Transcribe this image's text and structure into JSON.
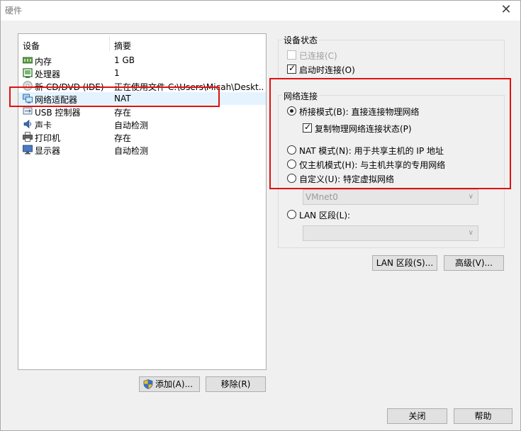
{
  "window": {
    "title": "硬件"
  },
  "device_list": {
    "col_device": "设备",
    "col_summary": "摘要",
    "rows": [
      {
        "name": "内存",
        "summary": "1 GB",
        "icon": "memory-icon",
        "iconColor": "#4a8a3a"
      },
      {
        "name": "处理器",
        "summary": "1",
        "icon": "processor-icon",
        "iconColor": "#3a7a3a"
      },
      {
        "name": "新 CD/DVD (IDE)",
        "summary": "正在使用文件 C:\\Users\\Micah\\Deskt...",
        "icon": "cd-dvd-icon",
        "iconColor": "#9a9a9a"
      },
      {
        "name": "网络适配器",
        "summary": "NAT",
        "icon": "network-adapter-icon",
        "iconColor": "#2a6aa0"
      },
      {
        "name": "USB 控制器",
        "summary": "存在",
        "icon": "usb-icon",
        "iconColor": "#4a6a8a"
      },
      {
        "name": "声卡",
        "summary": "自动检测",
        "icon": "sound-card-icon",
        "iconColor": "#2a5a9a"
      },
      {
        "name": "打印机",
        "summary": "存在",
        "icon": "printer-icon",
        "iconColor": "#555555"
      },
      {
        "name": "显示器",
        "summary": "自动检测",
        "icon": "monitor-icon",
        "iconColor": "#2a5a9a"
      }
    ],
    "selected_index": 3
  },
  "buttons": {
    "add": "添加(A)...",
    "remove": "移除(R)",
    "lan_segments": "LAN 区段(S)...",
    "advanced": "高级(V)...",
    "close": "关闭",
    "help": "帮助"
  },
  "device_status": {
    "title": "设备状态",
    "connected": {
      "label": "已连接(C)",
      "checked": false,
      "disabled": true
    },
    "connect_at_power_on": {
      "label": "启动时连接(O)",
      "checked": true,
      "disabled": false
    }
  },
  "network_connection": {
    "title": "网络连接",
    "bridged": {
      "label": "桥接模式(B): 直接连接物理网络",
      "selected": true
    },
    "replicate": {
      "label": "复制物理网络连接状态(P)",
      "checked": true
    },
    "nat": {
      "label": "NAT 模式(N): 用于共享主机的 IP 地址",
      "selected": false
    },
    "host_only": {
      "label": "仅主机模式(H): 与主机共享的专用网络",
      "selected": false
    },
    "custom": {
      "label": "自定义(U): 特定虚拟网络",
      "selected": false
    },
    "custom_select_value": "VMnet0",
    "lan_segment": {
      "label": "LAN 区段(L):",
      "selected": false
    },
    "lan_segment_select_value": ""
  },
  "highlight_color": "#e01010"
}
